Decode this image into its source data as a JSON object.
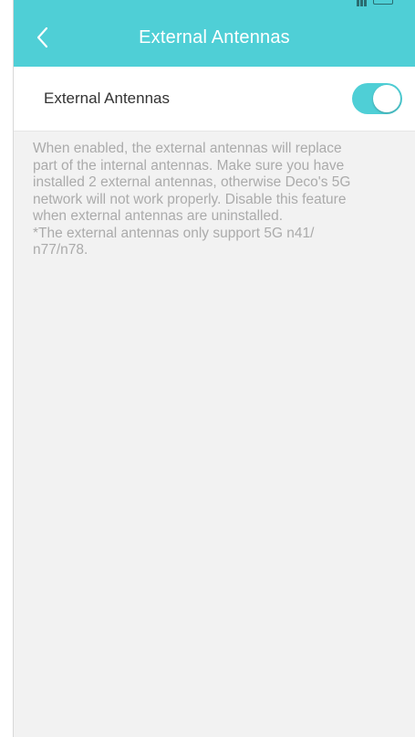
{
  "header": {
    "title": "External Antennas",
    "background_color": "#4fcfd6",
    "back_icon": "chevron-left-icon"
  },
  "setting": {
    "label": "External Antennas",
    "toggle_on": true,
    "toggle_color": "#4fcfd6"
  },
  "description": {
    "lines": [
      "When enabled, the external antennas will replace",
      "part of the internal antennas. Make sure you have",
      "installed 2 external antennas, otherwise Deco's 5G",
      "network will not work properly. Disable this feature",
      "when external antennas are uninstalled.",
      "*The external antennas only support 5G n41/",
      "n77/n78."
    ]
  }
}
